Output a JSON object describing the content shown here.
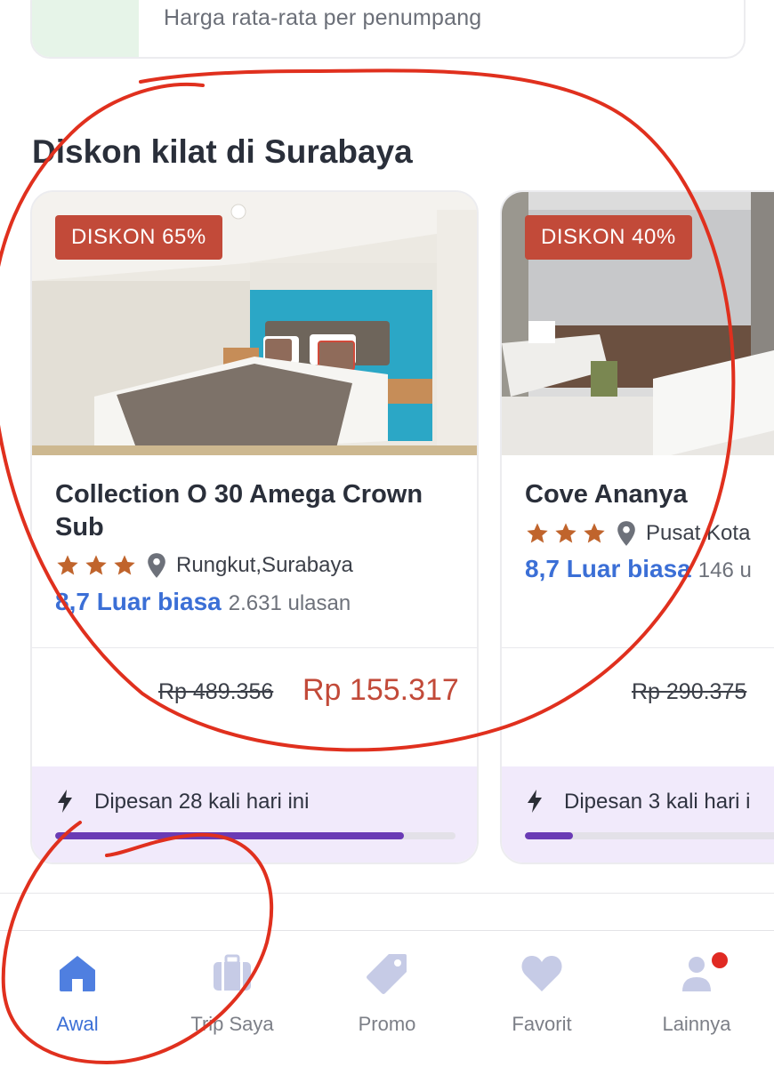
{
  "top_card": {
    "text": "Harga rata-rata per penumpang"
  },
  "section": {
    "title": "Diskon kilat di Surabaya"
  },
  "colors": {
    "discount": "#c24a39",
    "rating": "#3b6fd6",
    "star": "#c0642c",
    "progress": "#6a3bb5",
    "booked_bg": "#f1eafb",
    "nav_active": "#3b6fd6",
    "nav_inactive": "#c6cbe6",
    "annotation": "#e0301e"
  },
  "hotels": [
    {
      "badge": "DISKON 65%",
      "name": "Collection O 30 Amega Crown Sub",
      "stars": 3,
      "location": "Rungkut,Surabaya",
      "rating": "8,7 Luar biasa",
      "reviews": "2.631 ulasan",
      "old_price": "Rp 489.356",
      "new_price": "Rp 155.317",
      "booked": "Dipesan 28 kali hari ini",
      "booked_progress": 0.87
    },
    {
      "badge": "DISKON 40%",
      "name": "Cove Ananya",
      "stars": 3,
      "location": "Pusat Kota",
      "rating": "8,7 Luar biasa",
      "reviews": "146 u",
      "old_price": "Rp 290.375",
      "booked": "Dipesan 3 kali hari i",
      "booked_progress": 0.12
    }
  ],
  "nav": {
    "items": [
      {
        "label": "Awal",
        "icon": "home-icon",
        "active": true
      },
      {
        "label": "Trip Saya",
        "icon": "suitcase-icon",
        "active": false
      },
      {
        "label": "Promo",
        "icon": "tag-icon",
        "active": false
      },
      {
        "label": "Favorit",
        "icon": "heart-icon",
        "active": false
      },
      {
        "label": "Lainnya",
        "icon": "person-icon",
        "active": false,
        "notification_dot": true
      }
    ]
  }
}
